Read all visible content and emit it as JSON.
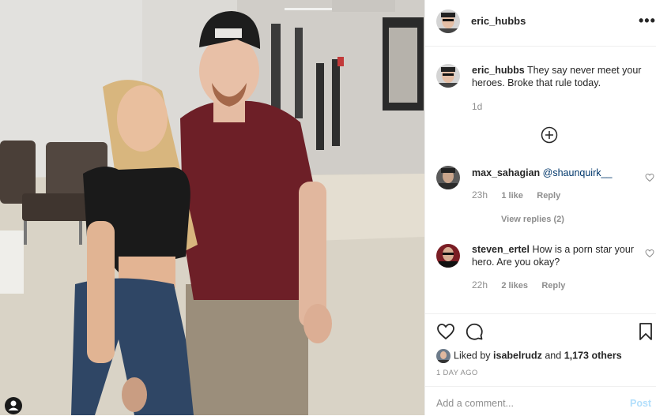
{
  "post": {
    "author": "eric_hubbs",
    "more_label": "•••",
    "caption": {
      "user": "eric_hubbs",
      "text": "They say never meet your heroes. Broke that rule today.",
      "age": "1d"
    }
  },
  "comments": [
    {
      "user": "max_sahagian",
      "mention": "@shaunquirk__",
      "text": "",
      "age": "23h",
      "likes": "1 like",
      "reply": "Reply",
      "view_replies": "View replies (2)"
    },
    {
      "user": "steven_ertel",
      "mention": "",
      "text": "How is a porn star your hero. Are you okay?",
      "age": "22h",
      "likes": "2 likes",
      "reply": "Reply"
    }
  ],
  "likes": {
    "prefix": "Liked by",
    "user": "isabelrudz",
    "middle": "and",
    "count": "1,173 others"
  },
  "time_ago": "1 DAY AGO",
  "add_comment": {
    "placeholder": "Add a comment...",
    "post_label": "Post"
  },
  "icons": {
    "like": "heart-icon",
    "comment": "comment-bubble-icon",
    "save": "bookmark-icon",
    "load_more": "plus-circle-icon",
    "options": "more-options-icon",
    "tagged": "user-tag-icon"
  },
  "colors": {
    "text": "#262626",
    "muted": "#8e8e8e",
    "mention": "#00376b",
    "post_disabled": "#b2dffc",
    "border": "#efefef"
  }
}
